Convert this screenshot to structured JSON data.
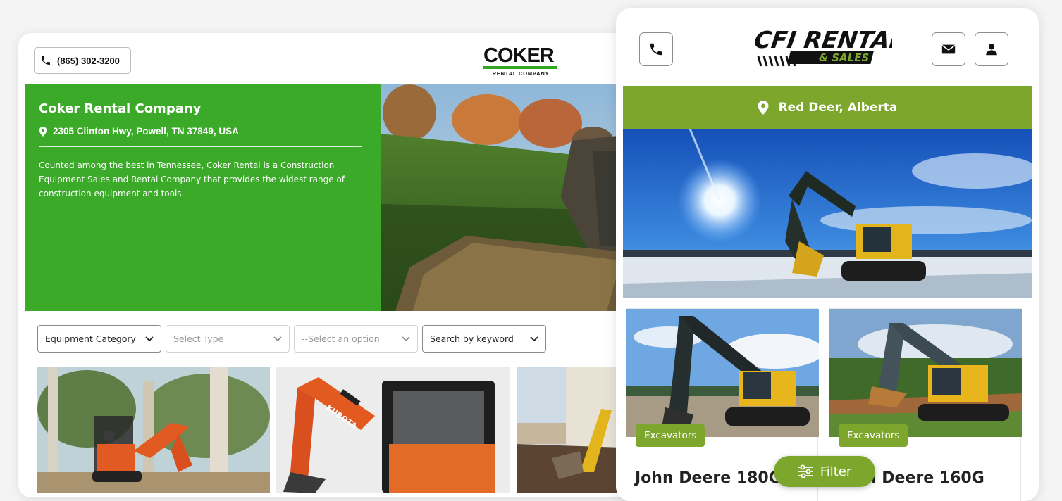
{
  "coker": {
    "phone": "(865) 302-3200",
    "logo": {
      "word": "COKER",
      "sub": "RENTAL COMPANY"
    },
    "hero": {
      "title": "Coker Rental Company",
      "address": "2305 Clinton Hwy, Powell, TN 37849, USA",
      "description": "Counted among the best in Tennessee, Coker Rental is a Construction Equipment Sales and Rental Company that provides the widest range of construction equipment and tools."
    },
    "filters": [
      {
        "label": "Equipment Category",
        "style": "dark"
      },
      {
        "label": "Select Type",
        "style": "light"
      },
      {
        "label": "--Select an option",
        "style": "light"
      },
      {
        "label": "Search by keyword",
        "style": "dark"
      }
    ],
    "colors": {
      "brand_green": "#3aaa28"
    }
  },
  "cfi": {
    "logo": {
      "line1": "CFI RENTALS",
      "line2": "& SALES"
    },
    "location": "Red Deer, Alberta",
    "cards": [
      {
        "badge": "Excavators",
        "title": "John Deere 180G"
      },
      {
        "badge": "Excavators",
        "title": "John Deere 160G"
      }
    ],
    "filter_button": "Filter",
    "icons": {
      "phone": "phone-icon",
      "email": "envelope-icon",
      "account": "user-icon",
      "location": "map-pin-icon",
      "filter": "sliders-icon"
    },
    "colors": {
      "brand_green": "#7da62c"
    }
  }
}
